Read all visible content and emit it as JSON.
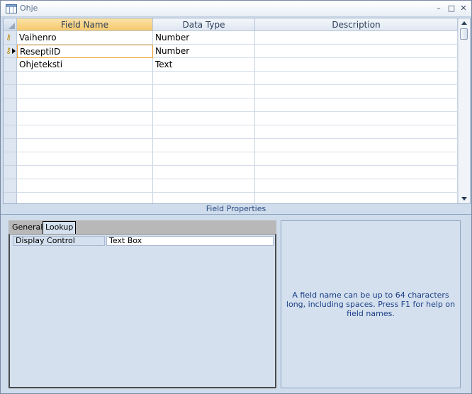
{
  "window": {
    "title": "Ohje",
    "minimize_icon": "minimize-icon",
    "restore_icon": "restore-icon",
    "close_icon": "close-icon"
  },
  "grid": {
    "columns": [
      "Field Name",
      "Data Type",
      "Description"
    ],
    "rows": [
      {
        "field": "Vaihenro",
        "type": "Number",
        "description": "",
        "primary_key": true
      },
      {
        "field": "ReseptiID",
        "type": "Number",
        "description": "",
        "primary_key": true,
        "current": true
      },
      {
        "field": "Ohjeteksti",
        "type": "Text",
        "description": ""
      }
    ],
    "empty_rows": 10
  },
  "field_properties": {
    "title": "Field Properties",
    "tabs": [
      "General",
      "Lookup"
    ],
    "active_tab": "Lookup",
    "properties": [
      {
        "label": "Display Control",
        "value": "Text Box"
      }
    ]
  },
  "help_text": "A field name can be up to 64 characters long, including spaces.  Press F1 for help on field names.",
  "colors": {
    "header_selected": "#f6c86b",
    "pane_bg": "#d4e0ee",
    "help_text": "#1c3f86"
  }
}
